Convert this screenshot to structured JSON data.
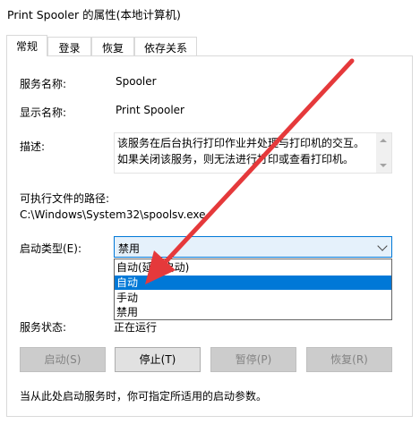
{
  "window": {
    "title": "Print Spooler 的属性(本地计算机)"
  },
  "tabs": [
    {
      "label": "常规",
      "active": true
    },
    {
      "label": "登录",
      "active": false
    },
    {
      "label": "恢复",
      "active": false
    },
    {
      "label": "依存关系",
      "active": false
    }
  ],
  "general": {
    "service_name_label": "服务名称:",
    "service_name_value": "Spooler",
    "display_name_label": "显示名称:",
    "display_name_value": "Print Spooler",
    "description_label": "描述:",
    "description_value": "该服务在后台执行打印作业并处理与打印机的交互。如果关闭该服务，则无法进行打印或查看打印机。",
    "exe_path_label": "可执行文件的路径:",
    "exe_path_value": "C:\\Windows\\System32\\spoolsv.exe",
    "startup_type_label": "启动类型(E):",
    "startup_type_value": "禁用",
    "startup_options": [
      "自动(延迟启动)",
      "自动",
      "手动",
      "禁用"
    ],
    "startup_options_highlighted_index": 1,
    "status_label": "服务状态:",
    "status_value": "正在运行",
    "buttons": {
      "start": "启动(S)",
      "stop": "停止(T)",
      "pause": "暂停(P)",
      "resume": "恢复(R)"
    },
    "hint_text": "当从此处启动服务时，你可指定所适用的启动参数。"
  },
  "colors": {
    "highlight": "#0078d7",
    "annotation_arrow": "#e5393b"
  }
}
